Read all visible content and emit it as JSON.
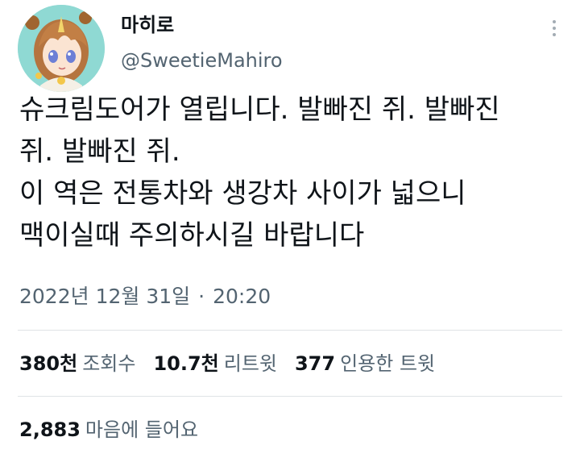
{
  "author": {
    "display_name": "마히로",
    "handle": "@SweetieMahiro"
  },
  "tweet": {
    "lines": [
      "슈크림도어가 열립니다. 발빠진 쥐. 발빠진",
      "쥐. 발빠진 쥐.",
      "이 역은 전통차와 생강차 사이가 넓으니",
      "맥이실때 주의하시길 바랍니다"
    ],
    "date": "2022년 12월 31일",
    "separator": "·",
    "time": "20:20"
  },
  "stats": {
    "views": {
      "count": "380천",
      "label": "조회수"
    },
    "retweets": {
      "count": "10.7천",
      "label": "리트윗"
    },
    "quotes": {
      "count": "377",
      "label": "인용한 트윗"
    },
    "likes": {
      "count": "2,883",
      "label": "마음에 들어요"
    }
  },
  "icons": {
    "more": "more-options-icon"
  },
  "colors": {
    "text": "#0f1419",
    "secondary": "#536471",
    "divider": "#dfe3e6",
    "avatar_bg": "#8fd9d3"
  }
}
